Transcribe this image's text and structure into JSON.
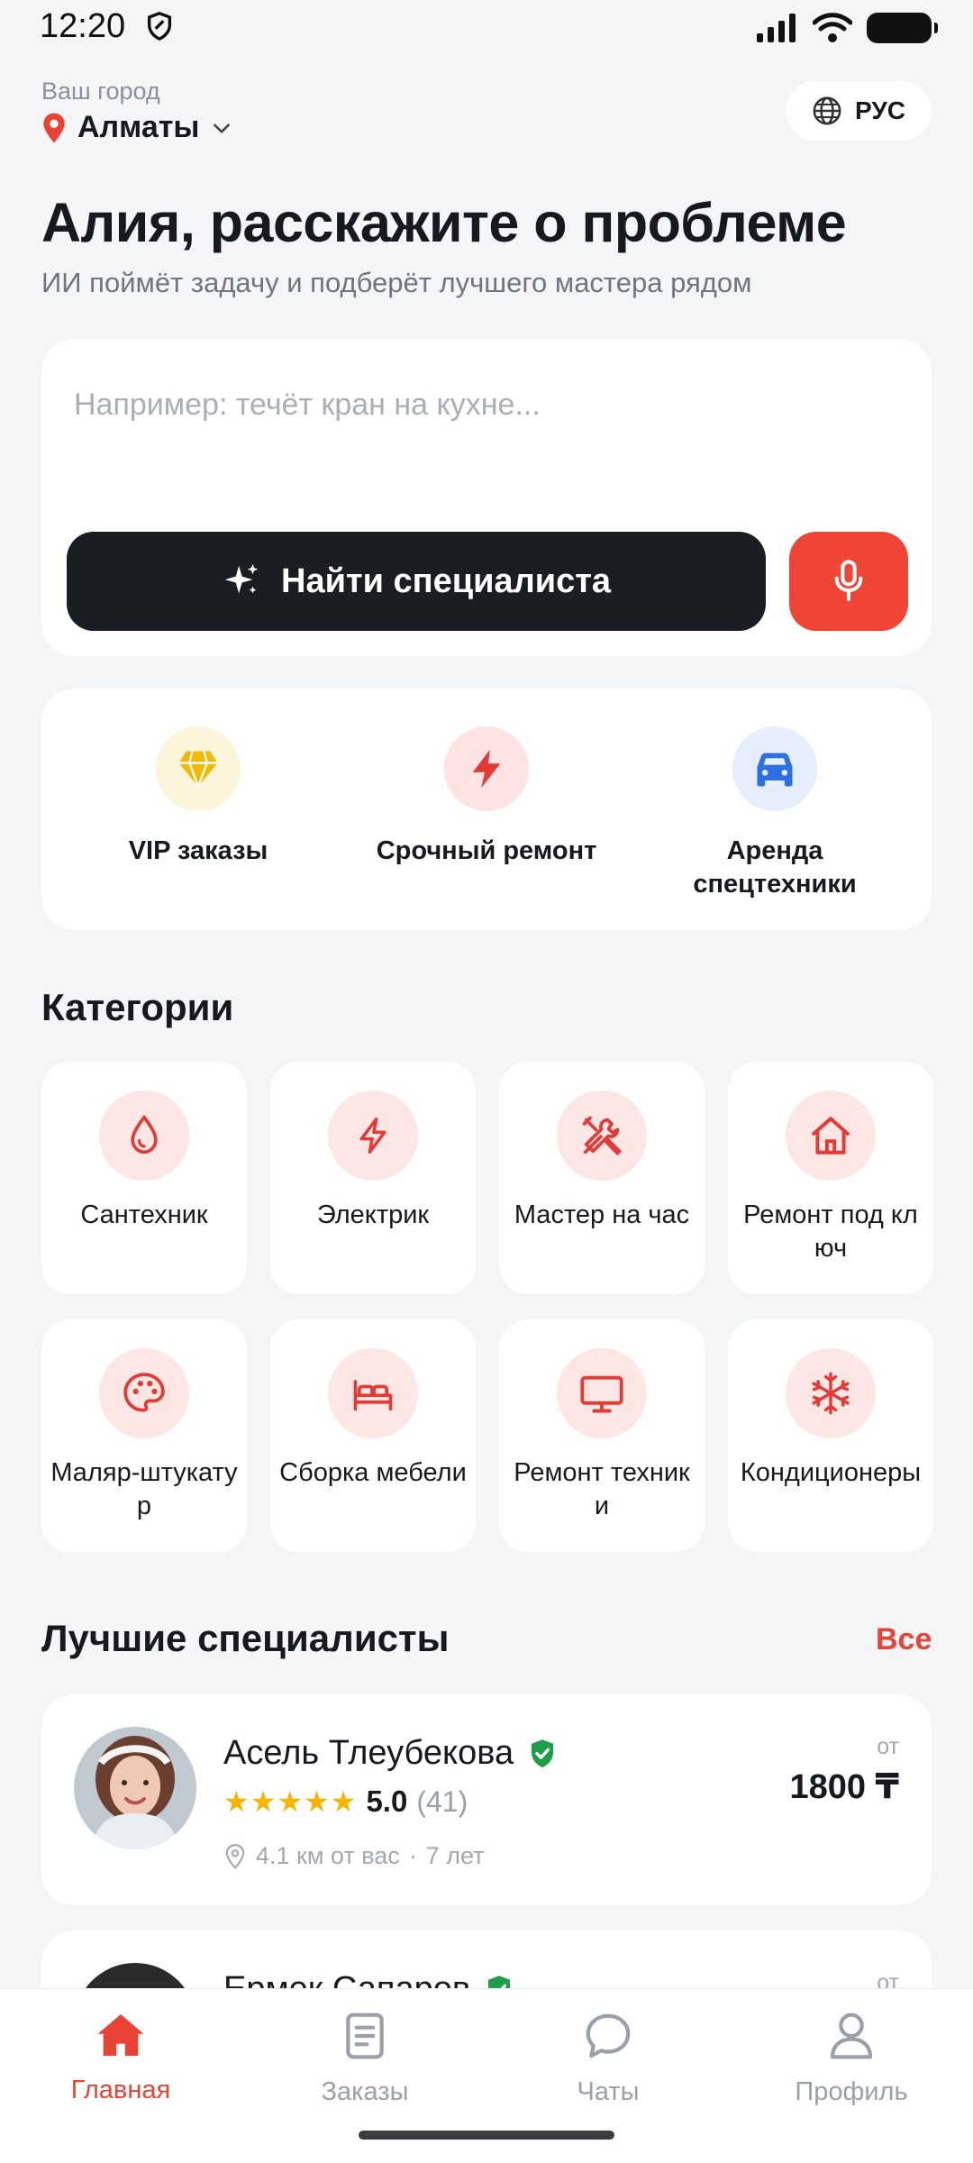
{
  "status_bar": {
    "time": "12:20"
  },
  "header": {
    "city_caption": "Ваш город",
    "city": "Алматы",
    "language": "РУС"
  },
  "hero": {
    "title": "Алия, расскажите о проблеме",
    "subtitle": "ИИ поймёт задачу и подберёт лучшего мастера рядом"
  },
  "search": {
    "placeholder": "Например: течёт кран на кухне...",
    "value": "",
    "find_button": "Найти специалиста"
  },
  "quick_actions": [
    {
      "label": "VIP заказы",
      "icon": "diamond-icon"
    },
    {
      "label": "Срочный ремонт",
      "icon": "lightning-icon"
    },
    {
      "label": "Аренда спецтехники",
      "icon": "car-icon"
    }
  ],
  "categories": {
    "title": "Категории",
    "items": [
      {
        "label": "Сантехник",
        "icon": "drop-icon"
      },
      {
        "label": "Электрик",
        "icon": "bolt-icon"
      },
      {
        "label": "Мастер на час",
        "icon": "tools-icon"
      },
      {
        "label": "Ремонт под ключ",
        "icon": "house-icon"
      },
      {
        "label": "Маляр-штукатур",
        "icon": "palette-icon"
      },
      {
        "label": "Сборка мебели",
        "icon": "bed-icon"
      },
      {
        "label": "Ремонт техники",
        "icon": "monitor-icon"
      },
      {
        "label": "Кондиционеры",
        "icon": "snowflake-icon"
      }
    ]
  },
  "specialists": {
    "title": "Лучшие специалисты",
    "all_link": "Все",
    "items": [
      {
        "name": "Асель Тлеубекова",
        "stars": "★★★★★",
        "rating": "5.0",
        "reviews": "(41)",
        "distance": "4.1 км от вас",
        "experience": "7 лет",
        "price_prefix": "от",
        "price": "1800 ₸"
      },
      {
        "name": "Ермек Сапаров",
        "price_prefix": "от"
      }
    ]
  },
  "bottom_nav": [
    {
      "label": "Главная",
      "icon": "home-icon",
      "active": true
    },
    {
      "label": "Заказы",
      "icon": "orders-icon",
      "active": false
    },
    {
      "label": "Чаты",
      "icon": "chat-icon",
      "active": false
    },
    {
      "label": "Профиль",
      "icon": "profile-icon",
      "active": false
    }
  ],
  "colors": {
    "accent": "#EA4335",
    "dark_button": "#1A1D22",
    "background": "#F4F5F7",
    "star": "#F7B500",
    "verified": "#1E9E4A"
  }
}
